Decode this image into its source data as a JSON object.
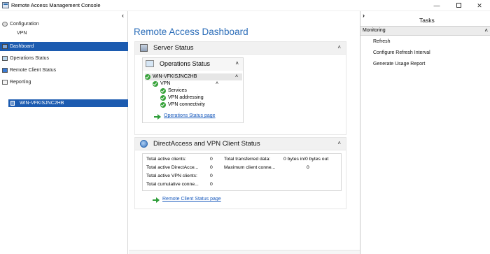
{
  "window": {
    "title": "Remote Access Management Console",
    "controls": {
      "minimize": "—",
      "close": "✕"
    }
  },
  "nav": {
    "collapse": "‹",
    "items": [
      {
        "label": "Configuration",
        "icon": "gear-icon"
      },
      {
        "label": "VPN",
        "icon": ""
      },
      {
        "label": "Dashboard",
        "icon": "dashboard-icon",
        "selected": true
      },
      {
        "label": "Operations Status",
        "icon": "operations-icon"
      },
      {
        "label": "Remote Client Status",
        "icon": "clients-icon"
      },
      {
        "label": "Reporting",
        "icon": "report-icon"
      }
    ],
    "server_node": "WIN-VFKISJNC2HB"
  },
  "main": {
    "title": "Remote Access Dashboard",
    "server_status": {
      "title": "Server Status",
      "collapse": "˄",
      "operations": {
        "title": "Operations Status",
        "collapse": "˄",
        "server": "WIN-VFKISJNC2HB",
        "vpn": "VPN",
        "components": [
          "Services",
          "VPN addressing",
          "VPN connectivity"
        ],
        "row_chevron": "˄",
        "link": "Operations Status page"
      }
    },
    "client_status": {
      "title": "DirectAccess and VPN Client Status",
      "collapse": "˄",
      "stats": [
        {
          "label": "Total active clients:",
          "value": "0"
        },
        {
          "label": "Total active DirectAcce...",
          "value": "0"
        },
        {
          "label": "Total active VPN clients:",
          "value": "0"
        },
        {
          "label": "Total cumulative conne...",
          "value": "0"
        }
      ],
      "stats_right": [
        {
          "label": "Total transferred data:",
          "value": "0 bytes in/0 bytes out"
        },
        {
          "label": "Maximum client conne...",
          "value": "0"
        }
      ],
      "link": "Remote Client Status page"
    }
  },
  "tasks": {
    "expand": "›",
    "title": "Tasks",
    "section": "Monitoring",
    "section_chevron": "˄",
    "items": [
      "Refresh",
      "Configure Refresh Interval",
      "Generate Usage Report"
    ]
  },
  "colors": {
    "accent": "#1c5bb0",
    "title_blue": "#2a6cb8",
    "ok_green": "#38a33b",
    "link": "#1a5bbd"
  }
}
